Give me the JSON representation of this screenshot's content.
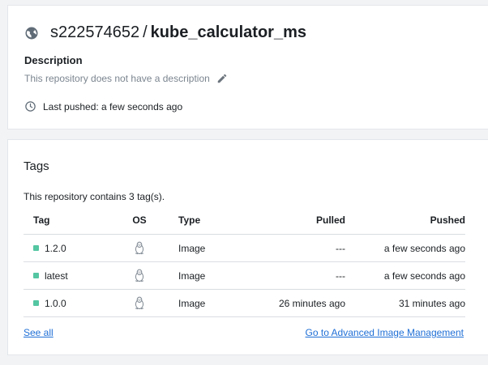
{
  "repo": {
    "namespace": "s222574652",
    "separator": "/",
    "name": "kube_calculator_ms",
    "description_heading": "Description",
    "description": "This repository does not have a description",
    "last_pushed": "Last pushed: a few seconds ago"
  },
  "tags": {
    "heading": "Tags",
    "count_text": "This repository contains 3 tag(s).",
    "columns": [
      "Tag",
      "OS",
      "Type",
      "Pulled",
      "Pushed"
    ],
    "rows": [
      {
        "tag": "1.2.0",
        "os": "linux",
        "type": "Image",
        "pulled": "---",
        "pushed": "a few seconds ago"
      },
      {
        "tag": "latest",
        "os": "linux",
        "type": "Image",
        "pulled": "---",
        "pushed": "a few seconds ago"
      },
      {
        "tag": "1.0.0",
        "os": "linux",
        "type": "Image",
        "pulled": "26 minutes ago",
        "pushed": "31 minutes ago"
      }
    ],
    "see_all": "See all",
    "advanced": "Go to Advanced Image Management"
  },
  "icons": {
    "repo": "globe-icon",
    "edit": "pencil-icon",
    "time": "clock-icon",
    "os": "linux-icon"
  },
  "colors": {
    "tag_status": "#54c6a2",
    "link": "#1f6fd6"
  }
}
